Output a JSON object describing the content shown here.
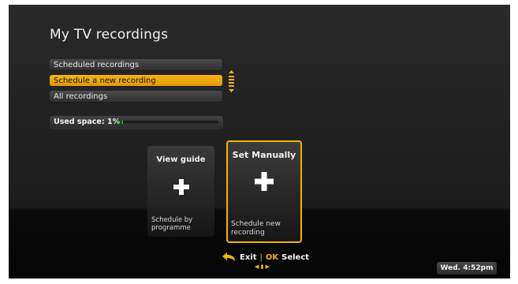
{
  "screen": {
    "title": "My TV recordings"
  },
  "menu": {
    "items": [
      {
        "label": "Scheduled recordings",
        "selected": false
      },
      {
        "label": "Schedule a new recording",
        "selected": true
      },
      {
        "label": "All recordings",
        "selected": false
      }
    ]
  },
  "storage": {
    "label": "Used space: 1%",
    "used_fraction": 0.01,
    "indicator_color": "#3ad13a"
  },
  "cards": {
    "view_guide": {
      "title": "View guide",
      "description_line1": "Schedule by",
      "description_line2": "programme",
      "icon": "plus-icon"
    },
    "set_manually": {
      "title": "Set Manually",
      "description_line1": "Schedule new",
      "description_line2": "recording",
      "icon": "plus-icon"
    }
  },
  "hints": {
    "exit_label": "Exit",
    "ok_label": "OK",
    "select_label": "Select",
    "exit_icon": "back-arrow-icon",
    "nav_icon": "left-right-arrows-icon"
  },
  "clock": {
    "value": "Wed. 4:52pm"
  },
  "colors": {
    "accent": "#f5b400",
    "background": "#222222",
    "progress": "#3ad13a"
  }
}
